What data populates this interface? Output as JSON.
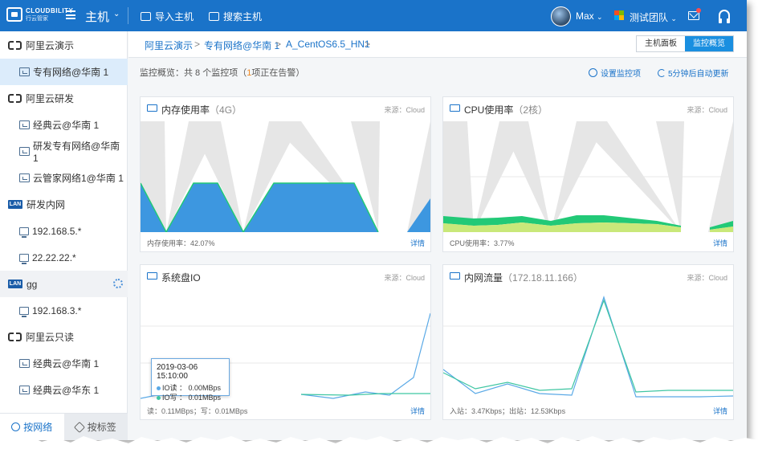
{
  "topbar": {
    "logo_en": "CLOUDBILITY",
    "logo_cn": "行云管家",
    "nav_title": "主机",
    "import_host": "导入主机",
    "search_host": "搜索主机",
    "user_name": "Max",
    "team_name": "测试团队",
    "caret": "⌄"
  },
  "sidebar": {
    "items": [
      {
        "label": "阿里云演示",
        "kind": "cloud"
      },
      {
        "label": "专有网络@华南 1",
        "kind": "vpc",
        "active": true
      },
      {
        "label": "阿里云研发",
        "kind": "cloud"
      },
      {
        "label": "经典云@华南 1",
        "kind": "classic"
      },
      {
        "label": "研发专有网络@华南 1",
        "kind": "vpc"
      },
      {
        "label": "云管家网络1@华南 1",
        "kind": "vpc"
      },
      {
        "label": "研发内网",
        "kind": "lan"
      },
      {
        "label": "192.168.5.*",
        "kind": "net"
      },
      {
        "label": "22.22.22.*",
        "kind": "net"
      },
      {
        "label": "gg",
        "kind": "lan"
      },
      {
        "label": "192.168.3.*",
        "kind": "net"
      },
      {
        "label": "阿里云只读",
        "kind": "cloud"
      },
      {
        "label": "经典云@华南 1",
        "kind": "classic"
      },
      {
        "label": "经典云@华东 1",
        "kind": "classic"
      }
    ],
    "lan_badge": "LAN",
    "tab_network": "按网络",
    "tab_tag": "按标签"
  },
  "breadcrumb": {
    "items": [
      "阿里云演示",
      "专有网络@华南 1",
      "A_CentOS6.5_HN1"
    ],
    "separator": ">",
    "view_host_panel": "主机面板",
    "view_monitor": "监控概览"
  },
  "summary": {
    "prefix": "监控概览：共 8 个监控项（",
    "warn_count": "1",
    "suffix": "项正在告警）",
    "setup_label": "设置监控项",
    "refresh_label": "5分钟后自动更新"
  },
  "panels": {
    "memory": {
      "title": "内存使用率",
      "sub": "（4G）",
      "source": "来源：Cloud",
      "stat": "内存使用率：42.07%",
      "detail": "详情"
    },
    "cpu": {
      "title": "CPU使用率",
      "sub": "（2核）",
      "source": "来源：Cloud",
      "stat": "CPU使用率：3.77%",
      "detail": "详情"
    },
    "disk": {
      "title": "系统盘IO",
      "sub": "",
      "source": "来源：Cloud",
      "stat": "读：0.11MBps；写：0.01MBps",
      "detail": "详情"
    },
    "network": {
      "title": "内网流量",
      "sub": "（172.18.11.166）",
      "source": "来源：Cloud",
      "stat": "入站：3.47Kbps；出站：12.53Kbps",
      "detail": "详情"
    }
  },
  "tooltip": {
    "date": "2019-03-06 15:10:00",
    "read": "IO读  ：  0.00MBps",
    "write": "IO写  ：  0.01MBps"
  },
  "colors": {
    "brand": "#1a73c9",
    "memory_fill": "#3d97e0",
    "cpu_green": "#22c977",
    "cpu_light": "#c9e87a",
    "gray_band": "#e6e6e6",
    "warn": "#f08a24"
  },
  "icons": {
    "logo": "logo-icon",
    "menu": "hamburger-icon",
    "mail": "mail-icon",
    "support": "headset-icon"
  }
}
